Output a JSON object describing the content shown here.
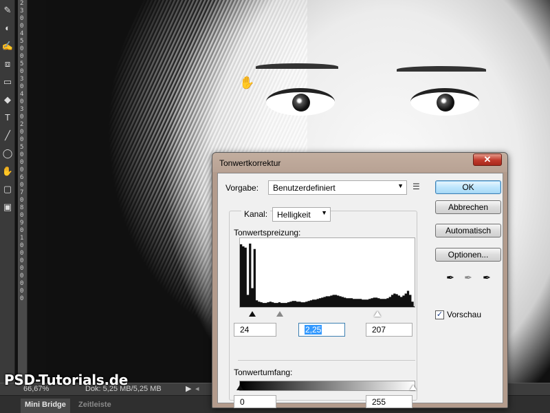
{
  "ruler": {
    "digits": "2300450050304030200500060708090100000000"
  },
  "tools": [
    "✎",
    "◐",
    "✍",
    "⧈",
    "▭",
    "◆",
    "T",
    "╱",
    "◯",
    "✋",
    "▢",
    "▣"
  ],
  "status": {
    "zoom": "66,67%",
    "doc": "Dok: 5,25 MB/5,25 MB"
  },
  "bottom_tabs": [
    {
      "label": "Mini Bridge",
      "active": true
    },
    {
      "label": "Zeitleiste",
      "active": false
    }
  ],
  "watermark": "PSD-Tutorials.de",
  "dialog": {
    "title": "Tonwertkorrektur",
    "close_label": "✕",
    "preset": {
      "label": "Vorgabe:",
      "value": "Benutzerdefiniert"
    },
    "channel": {
      "label": "Kanal:",
      "value": "Helligkeit"
    },
    "input_levels": {
      "label": "Tonwertspreizung:",
      "black": "24",
      "gamma": "2,25",
      "white": "207"
    },
    "output_levels": {
      "label": "Tonwertumfang:",
      "black": "0",
      "white": "255"
    },
    "buttons": {
      "ok": "OK",
      "cancel": "Abbrechen",
      "auto": "Automatisch",
      "options": "Optionen..."
    },
    "preview": {
      "label": "Vorschau",
      "checked": true
    }
  },
  "histogram": {
    "values": [
      95,
      92,
      90,
      20,
      96,
      30,
      88,
      12,
      10,
      9,
      8,
      8,
      9,
      10,
      9,
      8,
      8,
      9,
      8,
      8,
      8,
      9,
      10,
      11,
      11,
      10,
      10,
      9,
      9,
      10,
      11,
      12,
      13,
      13,
      14,
      15,
      16,
      17,
      18,
      18,
      19,
      20,
      20,
      19,
      18,
      17,
      16,
      15,
      15,
      15,
      14,
      14,
      14,
      14,
      13,
      13,
      13,
      14,
      15,
      16,
      16,
      15,
      14,
      14,
      14,
      15,
      17,
      20,
      22,
      21,
      19,
      17,
      19,
      22,
      26,
      20,
      10,
      3
    ]
  }
}
